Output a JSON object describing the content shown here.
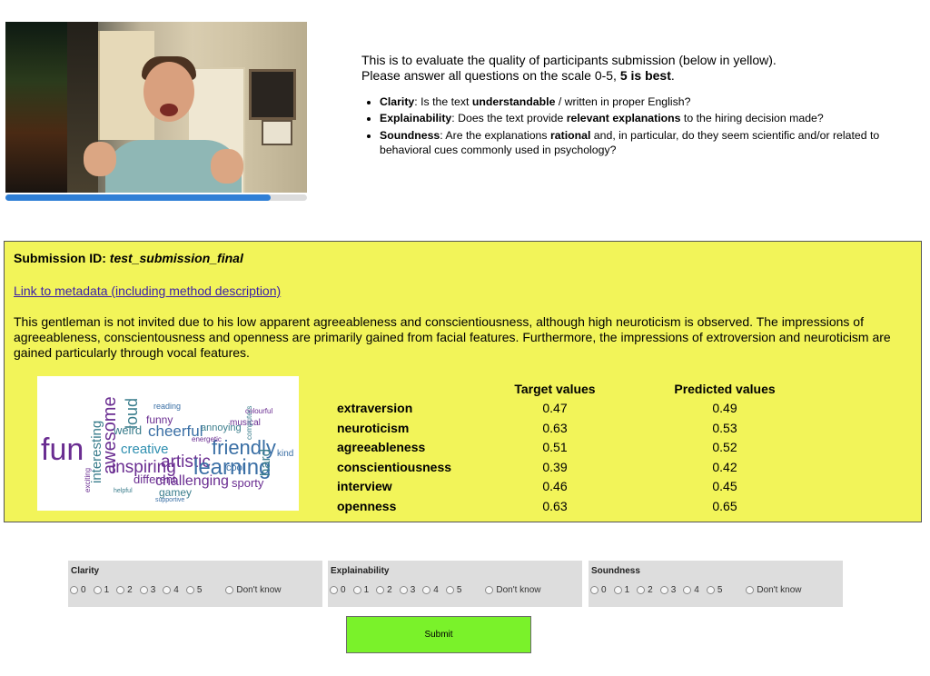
{
  "video": {
    "progress_fraction": 0.88
  },
  "instructions": {
    "line1": "This is to evaluate the quality of participants submission (below in yellow).",
    "line2_prefix": "Please answer all questions on the scale 0-5, ",
    "line2_bold": "5 is best",
    "line2_suffix": ".",
    "criteria": [
      {
        "name": "Clarity",
        "t1": ": Is the text ",
        "b1": "understandable",
        "t2": " / written in proper English?",
        "b2": "",
        "t3": ""
      },
      {
        "name": "Explainability",
        "t1": ": Does the text provide ",
        "b1": "relevant explanations",
        "t2": " to the hiring decision made?",
        "b2": "",
        "t3": ""
      },
      {
        "name": "Soundness",
        "t1": ": Are the explanations ",
        "b1": "rational",
        "t2": " and, in particular, do they seem scientific and/or related to behavioral cues commonly used in psychology?",
        "b2": "",
        "t3": ""
      }
    ]
  },
  "submission": {
    "id_label": "Submission ID: ",
    "id_value": "test_submission_final",
    "metadata_link": "Link to metadata (including method description)",
    "description": "This gentleman is not invited due to his low apparent agreeableness and conscientiousness, although high neuroticism is observed. The impressions of agreeableness, conscientousness and openness are primarily gained from facial features. Furthermore, the impressions of extroversion and neuroticism are gained particularly through vocal features.",
    "word_cloud": [
      {
        "w": "fun",
        "c": "#6a2d91"
      },
      {
        "w": "interesting",
        "c": "#3a7d8c"
      },
      {
        "w": "awesome",
        "c": "#6a2d91"
      },
      {
        "w": "loud",
        "c": "#3a7d8c"
      },
      {
        "w": "cheerful",
        "c": "#3a6fa5"
      },
      {
        "w": "funny",
        "c": "#6a2d91"
      },
      {
        "w": "weird",
        "c": "#3a7d8c"
      },
      {
        "w": "friendly",
        "c": "#3a6fa5"
      },
      {
        "w": "creative",
        "c": "#2f8fb0"
      },
      {
        "w": "inspiring",
        "c": "#6a2d91"
      },
      {
        "w": "artistic",
        "c": "#6a2d91"
      },
      {
        "w": "learning",
        "c": "#3a6fa5"
      },
      {
        "w": "hard",
        "c": "#3a7d8c"
      },
      {
        "w": "different",
        "c": "#6a2d91"
      },
      {
        "w": "challenging",
        "c": "#6a2d91"
      },
      {
        "w": "cool",
        "c": "#3a6fa5"
      },
      {
        "w": "gamey",
        "c": "#3a7d8c"
      },
      {
        "w": "sporty",
        "c": "#6a2d91"
      },
      {
        "w": "kind",
        "c": "#3a6fa5"
      },
      {
        "w": "musical",
        "c": "#6a2d91"
      },
      {
        "w": "annoying",
        "c": "#3a7d8c"
      },
      {
        "w": "reading",
        "c": "#3a6fa5"
      },
      {
        "w": "exciting",
        "c": "#6a2d91"
      },
      {
        "w": "helpful",
        "c": "#3a7d8c"
      },
      {
        "w": "energetic",
        "c": "#6a2d91"
      },
      {
        "w": "supportive",
        "c": "#3a6fa5"
      },
      {
        "w": "computers",
        "c": "#3a7d8c"
      },
      {
        "w": "colourful",
        "c": "#6a2d91"
      }
    ],
    "columns": {
      "target": "Target values",
      "predicted": "Predicted values"
    },
    "traits": [
      {
        "name": "extraversion",
        "target": "0.47",
        "predicted": "0.49"
      },
      {
        "name": "neuroticism",
        "target": "0.63",
        "predicted": "0.53"
      },
      {
        "name": "agreeableness",
        "target": "0.51",
        "predicted": "0.52"
      },
      {
        "name": "conscientiousness",
        "target": "0.39",
        "predicted": "0.42"
      },
      {
        "name": "interview",
        "target": "0.46",
        "predicted": "0.45"
      },
      {
        "name": "openness",
        "target": "0.63",
        "predicted": "0.65"
      }
    ]
  },
  "ratings": [
    {
      "label": "Clarity",
      "options": [
        "0",
        "1",
        "2",
        "3",
        "4",
        "5"
      ],
      "dont_know": "Don't know"
    },
    {
      "label": "Explainability",
      "options": [
        "0",
        "1",
        "2",
        "3",
        "4",
        "5"
      ],
      "dont_know": "Don't know"
    },
    {
      "label": "Soundness",
      "options": [
        "0",
        "1",
        "2",
        "3",
        "4",
        "5"
      ],
      "dont_know": "Don't know"
    }
  ],
  "submit_label": "Submit",
  "colors": {
    "panel": "#f2f459",
    "submit": "#7af22a",
    "rating_bg": "#dddddd",
    "progress": "#2f7fd6"
  }
}
